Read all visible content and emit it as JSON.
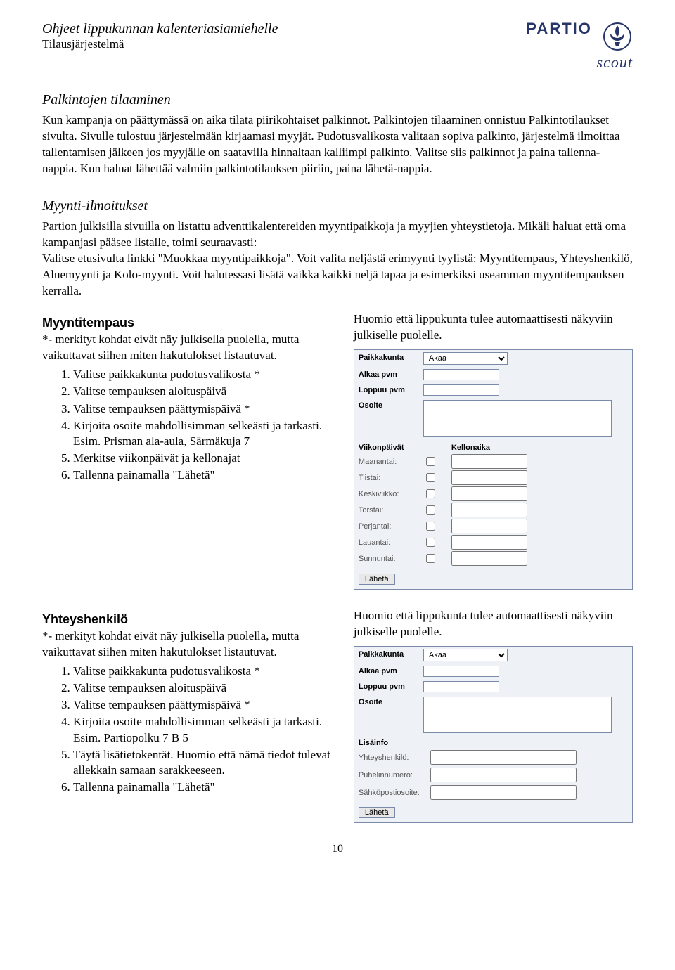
{
  "header": {
    "title": "Ohjeet lippukunnan kalenteriasiamiehelle",
    "subtitle": "Tilausjärjestelmä",
    "logo_top": "PARTIO",
    "logo_bottom": "scout"
  },
  "section1": {
    "title": "Palkintojen tilaaminen",
    "body": "Kun kampanja on päättymässä on aika tilata piirikohtaiset palkinnot. Palkintojen tilaaminen onnistuu Palkintotilaukset sivulta. Sivulle tulostuu järjestelmään kirjaamasi myyjät. Pudotusvalikosta valitaan sopiva palkinto, järjestelmä ilmoittaa tallentamisen jälkeen jos myyjälle on saatavilla hinnaltaan kalliimpi palkinto. Valitse siis palkinnot ja paina tallenna-nappia. Kun haluat lähettää valmiin palkintotilauksen piiriin, paina lähetä-nappia."
  },
  "section2": {
    "title": "Myynti-ilmoitukset",
    "body": "Partion julkisilla sivuilla on listattu adventtikalentereiden myyntipaikkoja ja myyjien yhteystietoja. Mikäli haluat että oma kampanjasi pääsee listalle, toimi seuraavasti:\nValitse etusivulta linkki \"Muokkaa myyntipaikkoja\". Voit valita neljästä erimyynti tyylistä: Myyntitempaus, Yhteyshenkilö, Aluemyynti ja Kolo-myynti. Voit halutessasi lisätä vaikka kaikki neljä tapaa ja esimerkiksi useamman myyntitempauksen kerralla."
  },
  "myyntitempaus": {
    "heading": "Myyntitempaus",
    "note": "*- merkityt kohdat eivät näy julkisella puolella, mutta vaikuttavat siihen miten hakutulokset listautuvat.",
    "steps": [
      "Valitse paikkakunta pudotusvalikosta *",
      "Valitse tempauksen aloituspäivä",
      "Valitse tempauksen päättymispäivä *",
      "Kirjoita osoite mahdollisimman selkeästi ja tarkasti. Esim. Prisman ala-aula, Särmäkuja 7",
      "Merkitse viikonpäivät ja kellonajat",
      "Tallenna painamalla \"Lähetä\""
    ],
    "right_note": "Huomio että lippukunta tulee automaattisesti näkyviin julkiselle puolelle."
  },
  "form1": {
    "labels": {
      "paikkakunta": "Paikkakunta",
      "alkaa": "Alkaa pvm",
      "loppuu": "Loppuu pvm",
      "osoite": "Osoite",
      "viikonpaivat": "Viikonpäivät",
      "kellonaika": "Kellonaika"
    },
    "paikkakunta_value": "Akaa",
    "days": [
      "Maanantai:",
      "Tiistai:",
      "Keskiviikko:",
      "Torstai:",
      "Perjantai:",
      "Lauantai:",
      "Sunnuntai:"
    ],
    "submit": "Lähetä"
  },
  "yhteyshenkilo": {
    "heading": "Yhteyshenkilö",
    "note": "*- merkityt kohdat eivät näy julkisella puolella, mutta vaikuttavat siihen miten hakutulokset listautuvat.",
    "steps": [
      "Valitse paikkakunta pudotusvalikosta *",
      "Valitse tempauksen aloituspäivä",
      "Valitse tempauksen päättymispäivä *",
      "Kirjoita osoite mahdollisimman selkeästi ja tarkasti. Esim. Partiopolku 7 B 5",
      "Täytä lisätietokentät. Huomio että nämä tiedot tulevat allekkain samaan sarakkeeseen.",
      "Tallenna painamalla \"Lähetä\""
    ],
    "right_note": "Huomio että lippukunta tulee automaattisesti näkyviin julkiselle puolelle."
  },
  "form2": {
    "labels": {
      "paikkakunta": "Paikkakunta",
      "alkaa": "Alkaa pvm",
      "loppuu": "Loppuu pvm",
      "osoite": "Osoite",
      "lisainfo": "Lisäinfo",
      "yhteyshenkilo": "Yhteyshenkilö:",
      "puhelin": "Puhelinnumero:",
      "sahkoposti": "Sähköpostiosoite:"
    },
    "paikkakunta_value": "Akaa",
    "submit": "Lähetä"
  },
  "page_number": "10"
}
